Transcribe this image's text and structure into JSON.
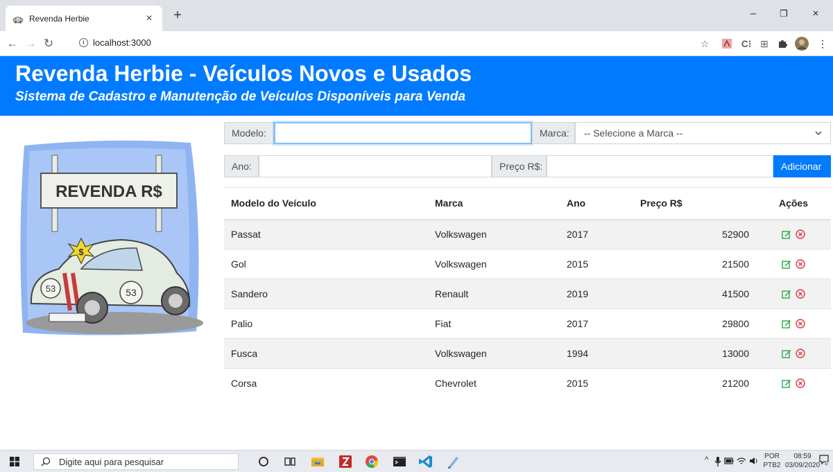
{
  "browser": {
    "tab_title": "Revenda Herbie",
    "tab_close": "×",
    "new_tab": "+",
    "url": "localhost:3000",
    "window_controls": {
      "minimize": "–",
      "maximize": "❐",
      "close": "×"
    }
  },
  "header": {
    "title": "Revenda Herbie - Veículos Novos e Usados",
    "subtitle": "Sistema de Cadastro e Manutenção de Veículos Disponíveis para Venda"
  },
  "illustration": {
    "sign_text": "REVENDA R$",
    "car_number": "53",
    "price_tag": "$"
  },
  "form": {
    "modelo_label": "Modelo:",
    "modelo_value": "",
    "marca_label": "Marca:",
    "marca_selected": "-- Selecione a Marca --",
    "ano_label": "Ano:",
    "ano_value": "",
    "preco_label": "Preço R$:",
    "preco_value": "",
    "add_button": "Adicionar"
  },
  "table": {
    "headers": [
      "Modelo do Veículo",
      "Marca",
      "Ano",
      "Preço R$",
      "Ações"
    ],
    "rows": [
      {
        "modelo": "Passat",
        "marca": "Volkswagen",
        "ano": "2017",
        "preco": "52900"
      },
      {
        "modelo": "Gol",
        "marca": "Volkswagen",
        "ano": "2015",
        "preco": "21500"
      },
      {
        "modelo": "Sandero",
        "marca": "Renault",
        "ano": "2019",
        "preco": "41500"
      },
      {
        "modelo": "Palio",
        "marca": "Fiat",
        "ano": "2017",
        "preco": "29800"
      },
      {
        "modelo": "Fusca",
        "marca": "Volkswagen",
        "ano": "1994",
        "preco": "13000"
      },
      {
        "modelo": "Corsa",
        "marca": "Chevrolet",
        "ano": "2015",
        "preco": "21200"
      }
    ]
  },
  "taskbar": {
    "search_placeholder": "Digite aqui para pesquisar",
    "lang_top": "POR",
    "lang_bottom": "PTB2",
    "time": "08:59",
    "date": "03/09/2020",
    "notifications": "5"
  },
  "colors": {
    "primary": "#007bff",
    "edit_icon": "#28a745",
    "delete_icon": "#dc3545",
    "stripe_row": "#f2f2f2"
  }
}
